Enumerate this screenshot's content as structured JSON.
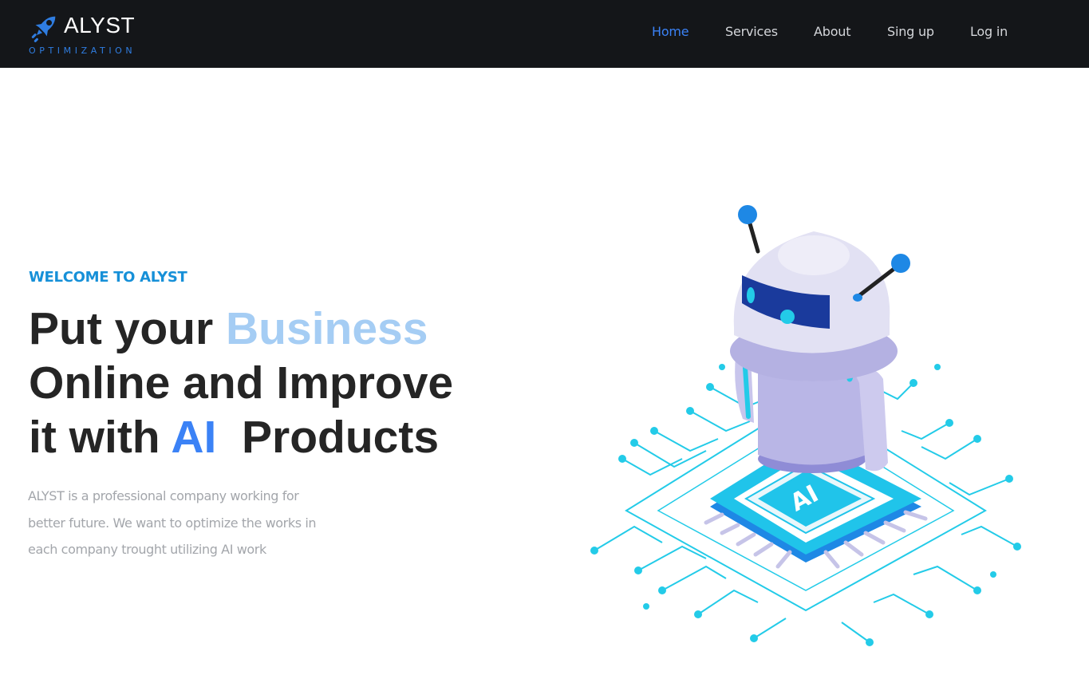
{
  "brand": {
    "name": "ALYST",
    "tagline": "OPTIMIZATION",
    "logo_icon": "rocket-icon",
    "accent_color": "#3b82f6",
    "header_bg": "#141619"
  },
  "nav": {
    "items": [
      {
        "label": "Home",
        "active": true
      },
      {
        "label": "Services",
        "active": false
      },
      {
        "label": "About",
        "active": false
      },
      {
        "label": "Sing up",
        "active": false
      },
      {
        "label": "Log in",
        "active": false
      }
    ]
  },
  "hero": {
    "kicker": "WELCOME TO ALYST",
    "title": {
      "line1_a": "Put your ",
      "line1_highlight": "Business",
      "line2": "Online and Improve",
      "line3_a": "it with ",
      "line3_highlight": "AI",
      "line3_b": "  Products"
    },
    "description": [
      "ALYST is a professional company working for",
      "better future. We want to optimize the works in",
      "each company trought utilizing AI work"
    ],
    "illustration": {
      "icon": "ai-robot-chip-illustration",
      "chip_label": "AI"
    }
  }
}
